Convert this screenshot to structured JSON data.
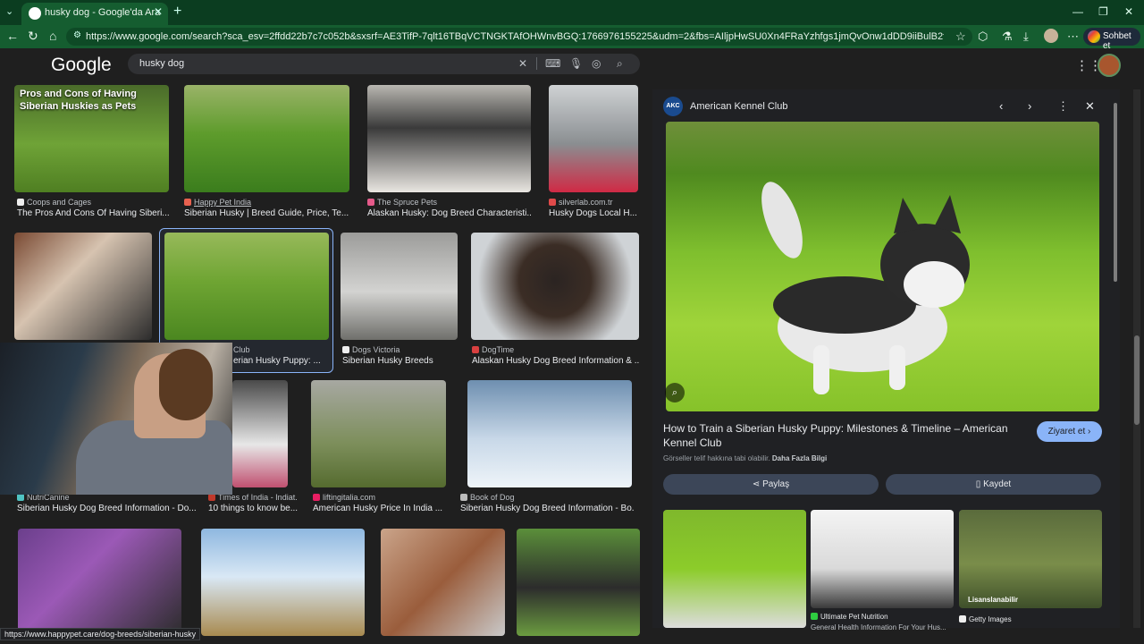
{
  "browser": {
    "tab_title": "husky dog - Google'da Ara",
    "url": "https://www.google.com/search?sca_esv=2ffdd22b7c7c052b&sxsrf=AE3TifP-7qlt16TBqVCTNGKTAfOHWnvBGQ:1766976155225&udm=2&fbs=AIljpHwSU0Xn4FRaYzhfgs1jmQvOnw1dDD9iiBulB2fsjeHv6XuKgDzU9KpxZMcpsjQNb1Wc...",
    "chat_label": "Sohbet et"
  },
  "google": {
    "logo": "Google",
    "query": "husky dog"
  },
  "results": [
    {
      "source": "Coops and Cages",
      "caption": "The Pros And Cons Of Having Siberi...",
      "overlay": "Pros and Cons of Having Siberian Huskies as Pets"
    },
    {
      "source": "Happy Pet India",
      "caption": "Siberian Husky | Breed Guide, Price, Te..."
    },
    {
      "source": "The Spruce Pets",
      "caption": "Alaskan Husky: Dog Breed Characteristi..."
    },
    {
      "source": "silverlab.com.tr",
      "caption": "Husky Dogs Local H..."
    },
    {
      "source": "Club",
      "caption": "erian Husky Puppy: ..."
    },
    {
      "source": "Dogs Victoria",
      "caption": "Siberian Husky Breeds"
    },
    {
      "source": "DogTime",
      "caption": "Alaskan Husky Dog Breed Information & ..."
    },
    {
      "source": "NutriCanine",
      "caption": "Siberian Husky Dog Breed Information - Do..."
    },
    {
      "source": "Times of India - Indiat...",
      "caption": "10 things to know be..."
    },
    {
      "source": "liftingitalia.com",
      "caption": "American Husky Price In India ..."
    },
    {
      "source": "Book of Dog",
      "caption": "Siberian Husky Dog Breed Information - Bo..."
    }
  ],
  "status_url": "https://www.happypet.care/dog-breeds/siberian-husky",
  "panel": {
    "source_badge": "AKC",
    "source_name": "American Kennel Club",
    "title": "How to Train a Siberian Husky Puppy: Milestones & Timeline – American Kennel Club",
    "visit_label": "Ziyaret et",
    "copyright_text": "Görseller telif hakkına tabi olabilir.",
    "more_info": "Daha Fazla Bilgi",
    "share_label": "Paylaş",
    "save_label": "Kaydet",
    "related": [
      {
        "source": "Ultimate Pet Nutrition",
        "caption": "General Health Information For Your Hus..."
      },
      {
        "source": "Getty Images",
        "badge": "Lisanslanabilir"
      }
    ]
  },
  "colors": {
    "chrome_green": "#155d30",
    "page_bg": "#1f1f1f",
    "accent_blue": "#8ab4f8"
  }
}
